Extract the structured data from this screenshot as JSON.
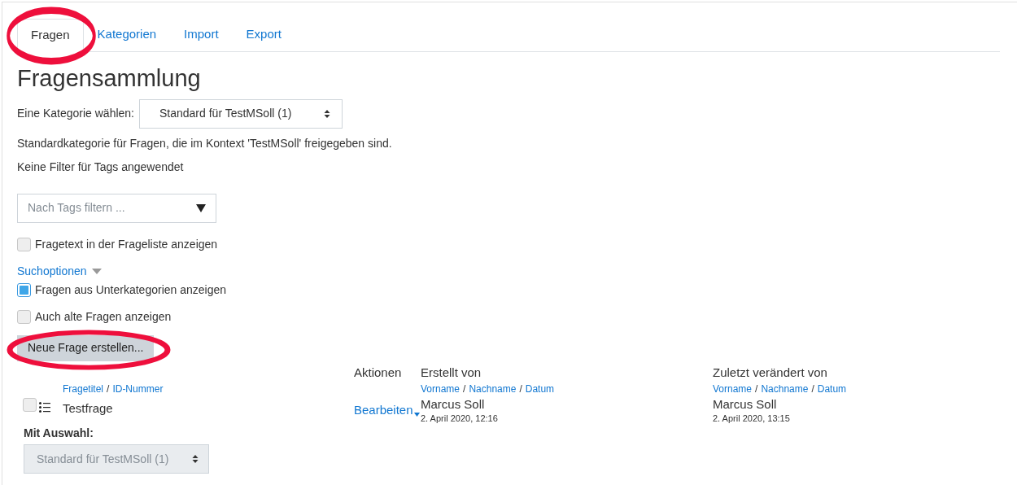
{
  "tabs": [
    {
      "label": "Fragen",
      "selected": true
    },
    {
      "label": "Kategorien",
      "selected": false
    },
    {
      "label": "Import",
      "selected": false
    },
    {
      "label": "Export",
      "selected": false
    }
  ],
  "title": "Fragensammlung",
  "category": {
    "label": "Eine Kategorie wählen:",
    "value": "Standard für TestMSoll (1)"
  },
  "category_description": "Standardkategorie für Fragen, die im Kontext 'TestMSoll' freigegeben sind.",
  "tag_filter_status": "Keine Filter für Tags angewendet",
  "tag_filter": {
    "placeholder": "Nach Tags filtern ..."
  },
  "show_text_option": {
    "label": "Fragetext in der Frageliste anzeigen",
    "checked": false
  },
  "search_options": {
    "label": "Suchoptionen",
    "expanded": true,
    "options": [
      {
        "label": "Fragen aus Unterkategorien anzeigen",
        "checked": true
      },
      {
        "label": "Auch alte Fragen anzeigen",
        "checked": false
      }
    ]
  },
  "create_button": "Neue Frage erstellen...",
  "table": {
    "columns": [
      {
        "kind": "name",
        "sort_links": [
          {
            "label": "Fragetitel"
          },
          {
            "separator": "/",
            "label": "ID-Nummer"
          }
        ]
      },
      {
        "kind": "actions",
        "label": "Aktionen"
      },
      {
        "kind": "user",
        "label": "Erstellt von",
        "sort_links": [
          {
            "label": "Vorname"
          },
          {
            "separator": "/",
            "label": "Nachname"
          },
          {
            "separator": "/",
            "label": "Datum"
          }
        ]
      },
      {
        "kind": "user",
        "label": "Zuletzt verändert von",
        "sort_links": [
          {
            "label": "Vorname"
          },
          {
            "separator": "/",
            "label": "Nachname"
          },
          {
            "separator": "/",
            "label": "Datum"
          }
        ]
      }
    ],
    "rows": [
      {
        "checked": false,
        "name": "Testfrage",
        "action": "Bearbeiten",
        "created_by": {
          "name": "Marcus Soll",
          "date": "2. April 2020, 12:16"
        },
        "modified_by": {
          "name": "Marcus Soll",
          "date": "2. April 2020, 13:15"
        }
      }
    ]
  },
  "with_selection": {
    "label": "Mit Auswahl:",
    "value": "Standard für TestMSoll (1)",
    "disabled": true
  }
}
